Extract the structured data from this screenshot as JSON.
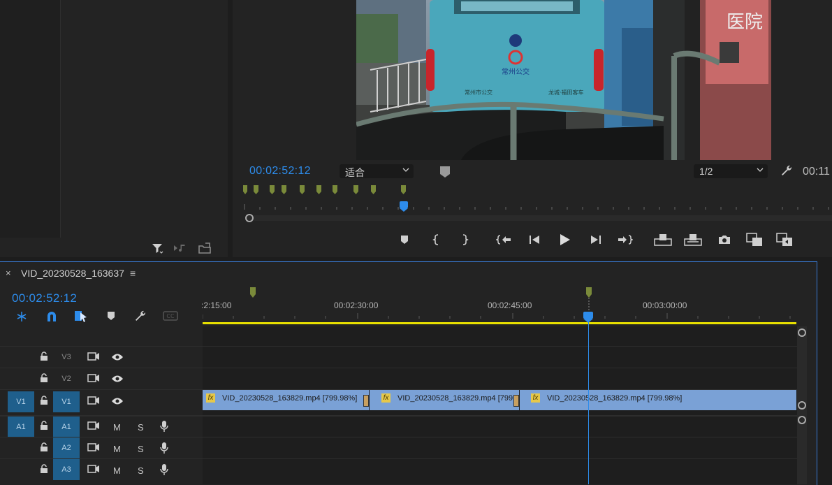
{
  "project_panel": {
    "icons": [
      "filter-icon",
      "automate-to-sequence-icon",
      "new-bin-icon"
    ]
  },
  "program_monitor": {
    "timecode": "00:02:52:12",
    "fit_select": "适合",
    "resolution_select": "1/2",
    "duration_timecode": "00:11",
    "controls": [
      "add-marker",
      "mark-in",
      "mark-out",
      "go-to-in",
      "step-back",
      "play",
      "step-forward",
      "go-to-out",
      "lift",
      "extract",
      "export-frame",
      "insert",
      "overwrite"
    ]
  },
  "video_frame": {
    "bus_sign": "常州公交",
    "bus_plate_left": "常州市公交",
    "bus_plate_right": "龙城·福田客车",
    "ad_text": "医院"
  },
  "sequence": {
    "tab_title": "VID_20230528_163637",
    "timecode": "00:02:52:12",
    "ruler_labels": [
      ":2:15:00",
      "00:02:30:00",
      "00:02:45:00",
      "00:03:00:00"
    ]
  },
  "tracks": [
    {
      "name": "V3",
      "type": "video",
      "target": ""
    },
    {
      "name": "V2",
      "type": "video",
      "target": ""
    },
    {
      "name": "V1",
      "type": "video",
      "target": "V1"
    },
    {
      "name": "A1",
      "type": "audio",
      "target": "A1"
    },
    {
      "name": "A2",
      "type": "audio",
      "target": ""
    },
    {
      "name": "A3",
      "type": "audio",
      "target": ""
    }
  ],
  "audio_buttons": {
    "mute": "M",
    "solo": "S"
  },
  "clips": [
    {
      "fx": "fx",
      "label": "VID_20230528_163829.mp4 [799.98%]"
    },
    {
      "fx": "fx",
      "label": "VID_20230528_163829.mp4 [799"
    },
    {
      "fx": "fx",
      "label": "VID_20230528_163829.mp4 [799.98%]"
    }
  ],
  "colors": {
    "accent_blue": "#2d8ceb",
    "clip_blue": "#7aa1d6",
    "marker_green": "#7a8a3a",
    "work_area_yellow": "#e8e000",
    "track_target": "#1f5f8c"
  }
}
